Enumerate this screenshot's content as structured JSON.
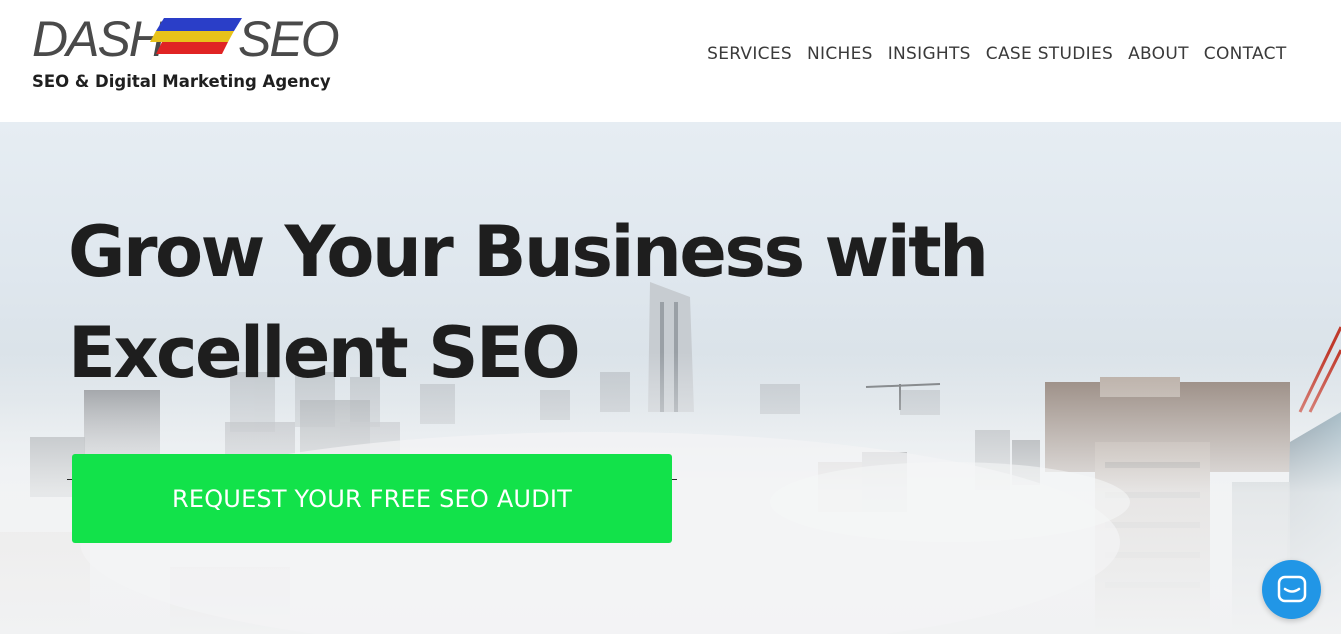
{
  "brand": {
    "logo_left": "DASH",
    "logo_right": "SEO",
    "tagline": "SEO & Digital Marketing Agency",
    "flag_colors": [
      "#2a3ec8",
      "#e8c21a",
      "#e02424"
    ]
  },
  "nav": {
    "items": [
      {
        "label": "SERVICES"
      },
      {
        "label": "NICHES"
      },
      {
        "label": "INSIGHTS"
      },
      {
        "label": "CASE STUDIES"
      },
      {
        "label": "ABOUT"
      },
      {
        "label": "CONTACT"
      }
    ]
  },
  "hero": {
    "headline_line1": "Grow Your Business with",
    "headline_line2": "Excellent SEO",
    "cta_label": "REQUEST YOUR FREE SEO AUDIT",
    "background": "foggy city skyline"
  },
  "chat": {
    "icon": "chat-bubble-icon",
    "color": "#2196e6"
  },
  "colors": {
    "cta": "#12e24a",
    "text_dark": "#1e1e1e"
  }
}
